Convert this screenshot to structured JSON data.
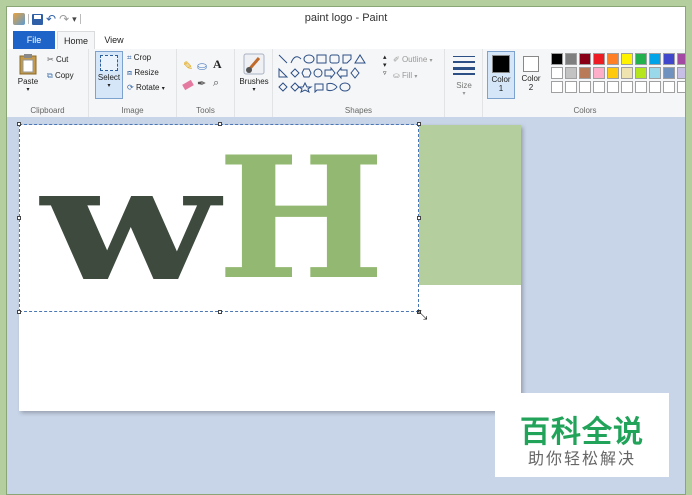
{
  "window": {
    "title": "paint logo - Paint"
  },
  "tabs": {
    "file": "File",
    "home": "Home",
    "view": "View"
  },
  "clipboard": {
    "paste": "Paste",
    "cut": "Cut",
    "copy": "Copy",
    "label": "Clipboard"
  },
  "image": {
    "select": "Select",
    "crop": "Crop",
    "resize": "Resize",
    "rotate": "Rotate",
    "label": "Image"
  },
  "tools": {
    "label": "Tools",
    "text_tool": "A"
  },
  "brushes": {
    "label": "Brushes"
  },
  "shapes": {
    "outline": "Outline",
    "fill": "Fill",
    "label": "Shapes"
  },
  "size": {
    "label": "Size"
  },
  "colors": {
    "color1_label": "Color",
    "color1_num": "1",
    "color2_label": "Color",
    "color2_num": "2",
    "label": "Colors",
    "color1": "#000000",
    "color2": "#ffffff",
    "palette_row1": [
      "#000000",
      "#7f7f7f",
      "#880015",
      "#ed1c24",
      "#ff7f27",
      "#fff200",
      "#22b14c",
      "#00a2e8",
      "#3f48cc",
      "#a349a4"
    ],
    "palette_row2": [
      "#ffffff",
      "#c3c3c3",
      "#b97a57",
      "#ffaec9",
      "#ffc90e",
      "#efe4b0",
      "#b5e61d",
      "#99d9ea",
      "#7092be",
      "#c8bfe7"
    ]
  },
  "canvas": {
    "letter_w": "w",
    "letter_h": "H",
    "w_color": "#3d4a3d",
    "h_color": "#93b871"
  },
  "watermark": {
    "line1": "百科全说",
    "line2": "助你轻松解决"
  }
}
